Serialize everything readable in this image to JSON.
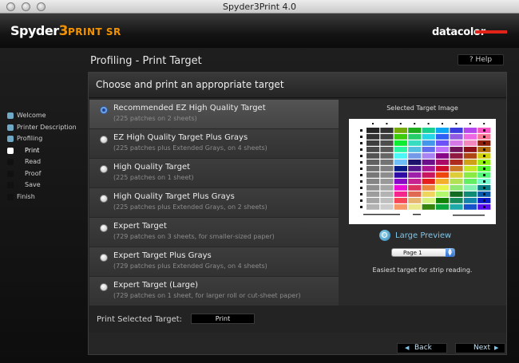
{
  "window": {
    "title": "Spyder3Print 4.0"
  },
  "header": {
    "logo_main": "Spyder",
    "logo_three": "3",
    "logo_print": "PRINT SR",
    "brand": "datacolor"
  },
  "page": {
    "title": "Profiling - Print Target",
    "help_label": "? Help"
  },
  "steps": [
    {
      "label": "Welcome"
    },
    {
      "label": "Printer Description"
    },
    {
      "label": "Profiling"
    },
    {
      "label": "Print"
    },
    {
      "label": "Read"
    },
    {
      "label": "Proof"
    },
    {
      "label": "Save"
    },
    {
      "label": "Finish"
    }
  ],
  "panel": {
    "heading": "Choose and print an appropriate target",
    "options": [
      {
        "title": "Recommended EZ High Quality Target",
        "subtitle": "(225 patches on 2 sheets)",
        "selected": true
      },
      {
        "title": "EZ High Quality Target Plus Grays",
        "subtitle": "(225 patches plus Extended Grays, on 4 sheets)"
      },
      {
        "title": "High Quality Target",
        "subtitle": "(225 patches on 1 sheet)"
      },
      {
        "title": "High Quality Target Plus Grays",
        "subtitle": "(225 patches plus Extended Grays, on 2 sheets)"
      },
      {
        "title": "Expert Target",
        "subtitle": "(729 patches on 3 sheets, for smaller-sized paper)"
      },
      {
        "title": "Expert Target Plus Grays",
        "subtitle": "(729 patches plus Extended Grays, on 4 sheets)"
      },
      {
        "title": "Expert Target (Large)",
        "subtitle": "(729 patches on 1 sheet, for larger roll or cut-sheet paper)"
      }
    ],
    "preview": {
      "label": "Selected Target Image",
      "large_preview": "Large Preview",
      "page_value": "Page 1",
      "hint": "Easiest target for strip reading."
    },
    "print": {
      "label": "Print Selected Target:",
      "button": "Print"
    }
  },
  "nav": {
    "back": "Back",
    "next": "Next"
  },
  "colors": {
    "accent_orange": "#f39200",
    "brand_red": "#e2231a",
    "step_done": "#6fa9c6",
    "link_blue": "#7ec6ea"
  }
}
